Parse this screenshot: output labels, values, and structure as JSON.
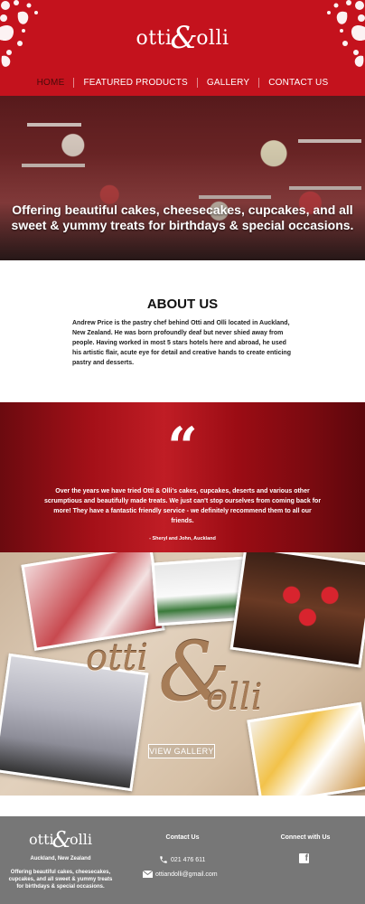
{
  "brand": {
    "logo_left": "otti",
    "logo_amp": "&",
    "logo_right": "olli"
  },
  "nav": [
    {
      "label": "HOME",
      "active": true
    },
    {
      "label": "FEATURED PRODUCTS",
      "active": false
    },
    {
      "label": "GALLERY",
      "active": false
    },
    {
      "label": "CONTACT US",
      "active": false
    }
  ],
  "hero": {
    "tagline": "Offering beautiful cakes, cheesecakes, cupcakes, and all sweet & yummy treats for birthdays & special occasions."
  },
  "about": {
    "heading": "ABOUT US",
    "body": "Andrew Price is the pastry chef behind Otti and Olli located in Auckland, New Zealand. He was born profoundly deaf but never shied away from people. Having worked in most 5 stars hotels here and abroad, he used his artistic flair, acute eye for detail and creative hands to create enticing pastry and desserts."
  },
  "testimonial": {
    "mark": "“",
    "quote": "Over the years we have tried Otti & Olli's cakes, cupcakes, deserts and various other scrumptious and beautifully made treats. We just can't stop ourselves from coming back for more! They have a fantastic friendly service - we definitely recommend them to all our friends.",
    "author": "- Sheryl and John, Auckland"
  },
  "gallery": {
    "button": "VIEW GALLERY",
    "word_left": "otti",
    "word_amp": "&",
    "word_right": "olli"
  },
  "footer": {
    "logo_left": "otti",
    "logo_amp": "&",
    "logo_right": "olli",
    "location": "Auckland, New Zealand",
    "description": "Offering beautiful cakes, cheesecakes, cupcakes, and all sweet & yummy treats for birthdays & special occasions.",
    "contact_heading": "Contact Us",
    "phone": "021 476 611",
    "email": "ottiandolli@gmail.com",
    "connect_heading": "Connect with Us",
    "social_icon": "facebook-icon"
  },
  "colors": {
    "brand_red": "#c4121d",
    "footer_gray": "#777777",
    "active_nav": "#4a0a0a"
  }
}
